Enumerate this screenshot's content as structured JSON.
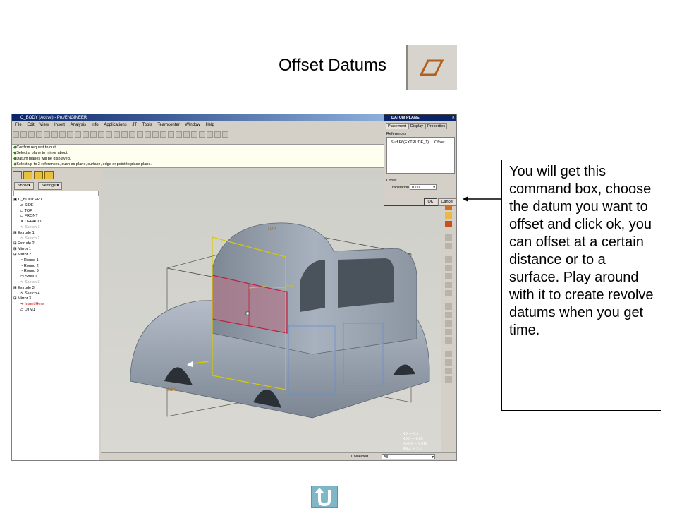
{
  "slide": {
    "title": "Offset Datums",
    "callout": "You will get this command box, choose the datum you want to offset and click ok, you can offset at a certain distance or to a surface.  Play around with it to create revolve datums when you get time."
  },
  "app": {
    "window_title": "C_BODY (Active) - Pro/ENGINEER",
    "menu": [
      "File",
      "Edit",
      "View",
      "Insert",
      "Analysis",
      "Info",
      "Applications",
      "JT",
      "Tools",
      "Teamcenter",
      "Window",
      "Help"
    ],
    "messages": [
      "Confirm request to quit.",
      "Select a plane to mirror about.",
      "Datum planes will be displayed.",
      "Select up to 3 references, such as plane, surface, edge or point to place plane."
    ],
    "panel": {
      "show_label": "Show ▾",
      "settings_label": "Settings ▾",
      "tree": [
        "C_BODY.PRT",
        "SIDE",
        "TOP",
        "FRONT",
        "DEFAULT",
        "Sketch 1",
        "Extrude 1",
        "Sketch 2",
        "Extrude 2",
        "Mirror 1",
        "Mirror 2",
        "Round 1",
        "Round 2",
        "Round 3",
        "Shell 1",
        "Sketch 3",
        "Extrude 3",
        "Sketch 4",
        "Mirror 3",
        "Insert Here",
        "DTM1"
      ]
    },
    "viewport": {
      "plane_top": "TOP",
      "plane_side": "SIDE",
      "offset_value": "0.00",
      "tolerances": [
        "X.X +- 0.1",
        "X.XX +- 0.03",
        "X.XXX +- 0.010",
        "ANG. +- 2.0"
      ]
    },
    "status": {
      "selected": "1 selected",
      "filter": "All"
    },
    "dialog": {
      "title": "DATUM PLANE",
      "tabs": [
        "Placement",
        "Display",
        "Properties"
      ],
      "references_label": "References",
      "reference_name": "Surf:F6(EXTRUDE_1)",
      "reference_type": "Offset",
      "offset_label": "Offset",
      "translation_label": "Translation",
      "translation_value": "0.00",
      "ok_label": "OK",
      "cancel_label": "Cancel"
    }
  },
  "colors": {
    "accent_callout_border": "#000000",
    "datum_plane_yellow": "#d8c800",
    "selection_red": "#c02040",
    "model_gray": "#8f99a6"
  }
}
